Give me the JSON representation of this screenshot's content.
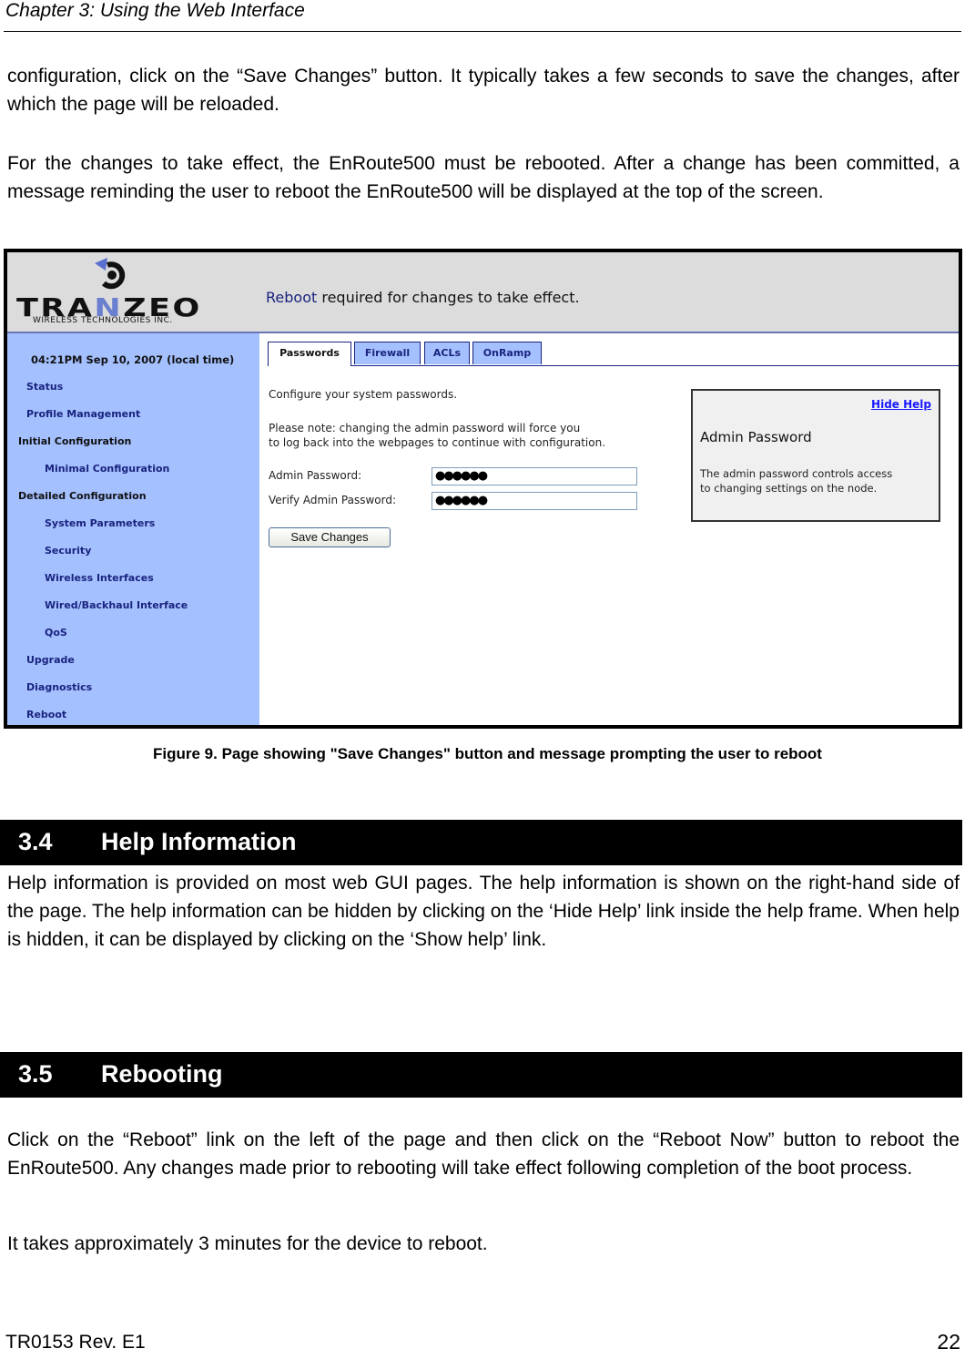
{
  "running_header": "Chapter 3: Using the Web Interface",
  "intro_paragraphs": [
    "configuration, click on the “Save Changes” button. It typically takes a few seconds to save the changes, after which the page will be reloaded.",
    "For the changes to take effect, the EnRoute500 must be rebooted. After a change has been committed, a message reminding the user to reboot the EnRoute500 will be displayed at the top of the screen."
  ],
  "figure": {
    "logo": {
      "brand_prefix": "TRA",
      "brand_n": "N",
      "brand_suffix": "ZEO",
      "subtitle": "WIRELESS TECHNOLOGIES INC."
    },
    "reboot_message": {
      "link": "Reboot",
      "text": " required for changes to take effect."
    },
    "sidebar": {
      "timestamp": "04:21PM Sep 10, 2007 (local time)",
      "items": [
        {
          "label": "Status",
          "type": "link",
          "level": 1
        },
        {
          "label": "Profile Management",
          "type": "link",
          "level": 1
        },
        {
          "label": "Initial Configuration",
          "type": "group",
          "level": 0
        },
        {
          "label": "Minimal Configuration",
          "type": "link",
          "level": 2
        },
        {
          "label": "Detailed Configuration",
          "type": "group",
          "level": 0
        },
        {
          "label": "System Parameters",
          "type": "link",
          "level": 2
        },
        {
          "label": "Security",
          "type": "link",
          "level": 2
        },
        {
          "label": "Wireless Interfaces",
          "type": "link",
          "level": 2
        },
        {
          "label": "Wired/Backhaul Interface",
          "type": "link",
          "level": 2
        },
        {
          "label": "QoS",
          "type": "link",
          "level": 2
        },
        {
          "label": "Upgrade",
          "type": "link",
          "level": 1
        },
        {
          "label": "Diagnostics",
          "type": "link",
          "level": 1
        },
        {
          "label": "Reboot",
          "type": "link",
          "level": 1
        }
      ]
    },
    "tabs": [
      {
        "label": "Passwords",
        "active": true
      },
      {
        "label": "Firewall",
        "active": false
      },
      {
        "label": "ACLs",
        "active": false
      },
      {
        "label": "OnRamp",
        "active": false
      }
    ],
    "content": {
      "intro": "Configure your system passwords.",
      "note_line1": "Please note: changing the admin password will force you",
      "note_line2": "to log back into the webpages to continue with configuration.",
      "admin_password_label": "Admin Password:",
      "admin_password_value": "●●●●●●",
      "verify_password_label": "Verify Admin Password:",
      "verify_password_value": "●●●●●●",
      "save_button": "Save Changes"
    },
    "help": {
      "hide_link": "Hide Help",
      "title": "Admin Password",
      "text_line1": "The admin password controls access",
      "text_line2": "to changing settings on the node."
    }
  },
  "caption": "Figure 9. Page showing \"Save Changes\" button and message prompting the user to reboot",
  "sections": [
    {
      "number": "3.4",
      "title": "Help Information",
      "paragraphs": [
        "Help information is provided on most web GUI pages. The help information is shown on the right-hand side of the page. The help information can be hidden by clicking on the ‘Hide Help’ link inside the help frame. When help is hidden, it can be displayed by clicking on the ‘Show help’ link."
      ]
    },
    {
      "number": "3.5",
      "title": "Rebooting",
      "paragraphs": [
        "Click on the “Reboot” link on the left of the page and then click on the “Reboot Now” button to reboot the EnRoute500. Any changes made prior to rebooting will take effect following completion of the boot process.",
        "It takes approximately 3 minutes for the device to reboot."
      ]
    }
  ],
  "footer": {
    "doc_id": "TR0153 Rev. E1",
    "page_number": "22"
  }
}
